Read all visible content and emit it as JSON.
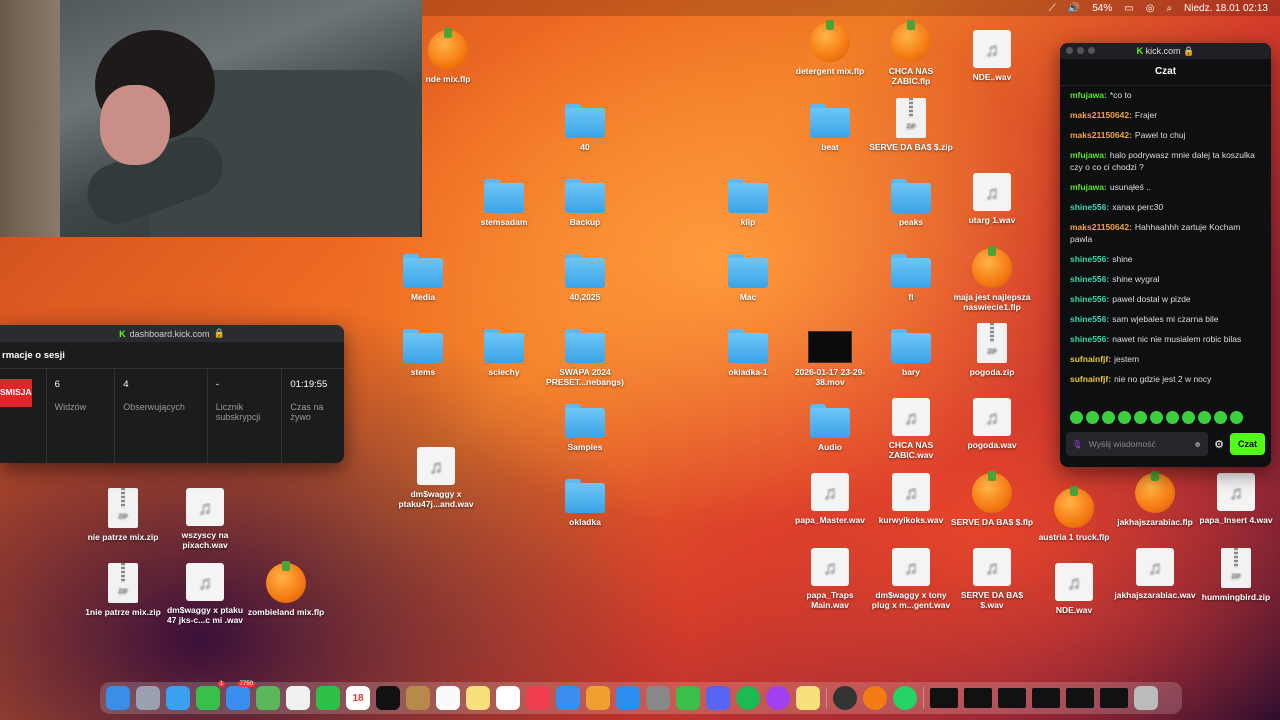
{
  "menubar": {
    "battery": "54%",
    "datetime": "Niedz. 18.01  02:13"
  },
  "desktop_icons": [
    {
      "type": "flp",
      "label": "nde mix.flp"
    },
    {
      "type": "flp",
      "label": "detergent mix.flp"
    },
    {
      "type": "flp",
      "label": "CHCA NAS ZABIC.flp"
    },
    {
      "type": "doc",
      "label": "NDE..wav"
    },
    {
      "type": "folder",
      "label": "40"
    },
    {
      "type": "folder",
      "label": "beat"
    },
    {
      "type": "zip",
      "label": "SERVE DA BA$ $.zip"
    },
    {
      "type": "folder",
      "label": "stemsadam"
    },
    {
      "type": "folder",
      "label": "Backup"
    },
    {
      "type": "folder",
      "label": "klip"
    },
    {
      "type": "folder",
      "label": "peaks"
    },
    {
      "type": "doc",
      "label": "utarg 1.wav"
    },
    {
      "type": "folder",
      "label": "Media"
    },
    {
      "type": "folder",
      "label": "40,2025"
    },
    {
      "type": "folder",
      "label": "Mac"
    },
    {
      "type": "folder",
      "label": "fl"
    },
    {
      "type": "flp",
      "label": "maja jest najlepsza naswiecie1.flp"
    },
    {
      "type": "folder",
      "label": "stems"
    },
    {
      "type": "folder",
      "label": "sciechy"
    },
    {
      "type": "folder",
      "label": "SWAPA 2024 PRESET...nebangs)"
    },
    {
      "type": "folder",
      "label": "okladka-1"
    },
    {
      "type": "mov",
      "label": "2026-01-17 23-29-38.mov"
    },
    {
      "type": "folder",
      "label": "bary"
    },
    {
      "type": "zip",
      "label": "pogoda.zip"
    },
    {
      "type": "doc",
      "label": "dm$waggy x ptaku47j...and.wav"
    },
    {
      "type": "folder",
      "label": "Samples"
    },
    {
      "type": "folder",
      "label": "Audio"
    },
    {
      "type": "doc",
      "label": "CHCA NAS ZABIC.wav"
    },
    {
      "type": "doc",
      "label": "pogoda.wav"
    },
    {
      "type": "zip",
      "label": "nie patrze mix.zip"
    },
    {
      "type": "doc",
      "label": "wszyscy na pixach.wav"
    },
    {
      "type": "folder",
      "label": "okladka"
    },
    {
      "type": "doc",
      "label": "papa_Master.wav"
    },
    {
      "type": "doc",
      "label": "kurwyikoks.wav"
    },
    {
      "type": "flp",
      "label": "SERVE DA BA$ $.flp"
    },
    {
      "type": "flp",
      "label": "austria 1 truck.flp"
    },
    {
      "type": "flp",
      "label": "jakhajszarabiac.flp"
    },
    {
      "type": "doc",
      "label": "papa_Insert 4.wav"
    },
    {
      "type": "zip",
      "label": "1nie patrze mix.zip"
    },
    {
      "type": "doc",
      "label": "dm$waggy x ptaku 47 jks-c...c mi .wav"
    },
    {
      "type": "flp",
      "label": "zombieland mix.flp"
    },
    {
      "type": "doc",
      "label": "papa_Traps Main.wav"
    },
    {
      "type": "doc",
      "label": "dm$waggy x tony plug x m...gent.wav"
    },
    {
      "type": "doc",
      "label": "SERVE DA BA$ $.wav"
    },
    {
      "type": "doc",
      "label": "NDE.wav"
    },
    {
      "type": "doc",
      "label": "jakhajszarabiac.wav"
    },
    {
      "type": "zip",
      "label": "hummingbird.zip"
    }
  ],
  "dashboard": {
    "url": "dashboard.kick.com",
    "title": "rmacje o sesji",
    "badge": "SMISJA",
    "stats": [
      {
        "value": "6",
        "label": "Widzów"
      },
      {
        "value": "4",
        "label": "Obserwujących"
      },
      {
        "value": "-",
        "label": "Licznik subskrypcji"
      },
      {
        "value": "01:19:55",
        "label": "Czas na żywo"
      }
    ]
  },
  "chat": {
    "url": "kick.com",
    "header": "Czat",
    "messages": [
      {
        "user": "mfujawa:",
        "color": "green",
        "text": "*co to"
      },
      {
        "user": "maks21150642:",
        "color": "orange",
        "text": "Frajer"
      },
      {
        "user": "maks21150642:",
        "color": "orange",
        "text": "Pawel to chuj"
      },
      {
        "user": "mfujawa:",
        "color": "green",
        "text": "halo podrywasz mnie dalej ta koszulka czy o co ci chodzi ?"
      },
      {
        "user": "mfujawa:",
        "color": "green",
        "text": "usunąłeś .."
      },
      {
        "user": "shine556:",
        "color": "teal",
        "text": "xanax perc30"
      },
      {
        "user": "maks21150642:",
        "color": "orange",
        "text": "Hahhaahhh zartuje Kocham pawla"
      },
      {
        "user": "shine556:",
        "color": "teal",
        "text": "shine"
      },
      {
        "user": "shine556:",
        "color": "teal",
        "text": "shine wygral"
      },
      {
        "user": "shine556:",
        "color": "teal",
        "text": "pawel dostal w pizde"
      },
      {
        "user": "shine556:",
        "color": "teal",
        "text": "sam wjebales mi czarna bile"
      },
      {
        "user": "shine556:",
        "color": "teal",
        "text": "nawet nic nie musialem robic bilas"
      },
      {
        "user": "sufnainfjf:",
        "color": "yellow",
        "text": "jestem"
      },
      {
        "user": "sufnainfjf:",
        "color": "yellow",
        "text": "nie no gdzie jest 2 w nocy"
      }
    ],
    "input_placeholder": "Wyślij wiadomość",
    "send_label": "Czat"
  },
  "dock": {
    "calendar_day": "18",
    "mail_badge": "7750",
    "messages_badge": "1"
  }
}
